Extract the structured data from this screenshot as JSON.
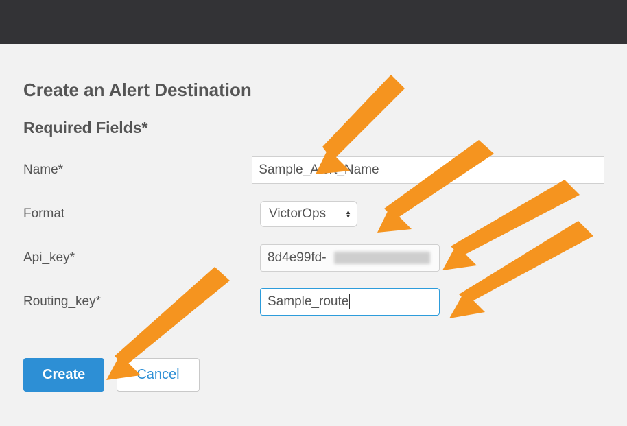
{
  "page": {
    "title": "Create an Alert Destination",
    "section": "Required Fields*"
  },
  "fields": {
    "name": {
      "label": "Name*",
      "value": "Sample_Alert_Name"
    },
    "format": {
      "label": "Format",
      "value": "VictorOps"
    },
    "api_key": {
      "label": "Api_key*",
      "value": "8d4e99fd-"
    },
    "routing_key": {
      "label": "Routing_key*",
      "value": "Sample_route"
    }
  },
  "buttons": {
    "create": "Create",
    "cancel": "Cancel"
  },
  "arrow_color": "#f5941f"
}
